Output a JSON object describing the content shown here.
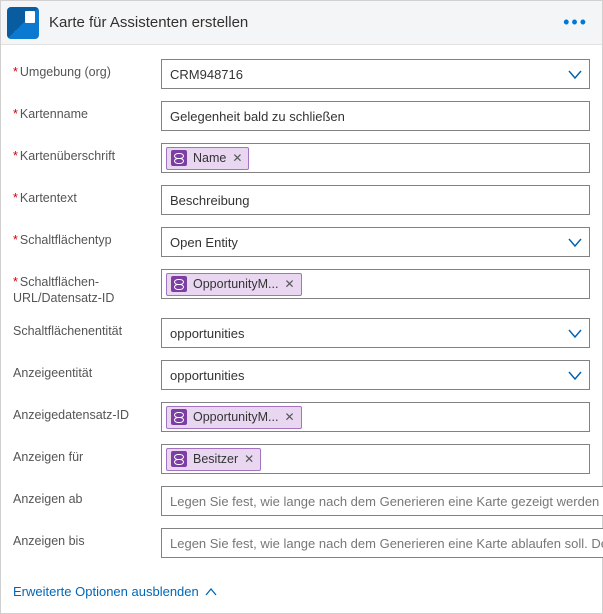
{
  "header": {
    "title": "Karte für Assistenten erstellen"
  },
  "fields": {
    "environment": {
      "label": "Umgebung (org)",
      "value": "CRM948716"
    },
    "cardName": {
      "label": "Kartenname",
      "value": "Gelegenheit bald zu schließen"
    },
    "cardHeader": {
      "label": "Kartenüberschrift",
      "token": "Name"
    },
    "cardText": {
      "label": "Kartentext",
      "value": "Beschreibung"
    },
    "buttonType": {
      "label": "Schaltflächentyp",
      "value": "Open Entity"
    },
    "buttonUrl": {
      "label": "Schaltflächen-URL/Datensatz-ID",
      "token": "OpportunityM..."
    },
    "buttonEntity": {
      "label": "Schaltflächenentität",
      "value": "opportunities"
    },
    "showEntity": {
      "label": "Anzeigeentität",
      "value": "opportunities"
    },
    "showRecordId": {
      "label": "Anzeigedatensatz-ID",
      "token": "OpportunityM..."
    },
    "showFor": {
      "label": "Anzeigen für",
      "token": "Besitzer"
    },
    "showFrom": {
      "label": "Anzeigen ab",
      "placeholder": "Legen Sie fest, wie lange nach dem Generieren eine Karte gezeigt werden soll. D"
    },
    "showTo": {
      "label": "Anzeigen bis",
      "placeholder": "Legen Sie fest, wie lange nach dem Generieren eine Karte ablaufen soll. Der Sta"
    }
  },
  "footer": {
    "advancedToggle": "Erweiterte Optionen ausblenden"
  }
}
